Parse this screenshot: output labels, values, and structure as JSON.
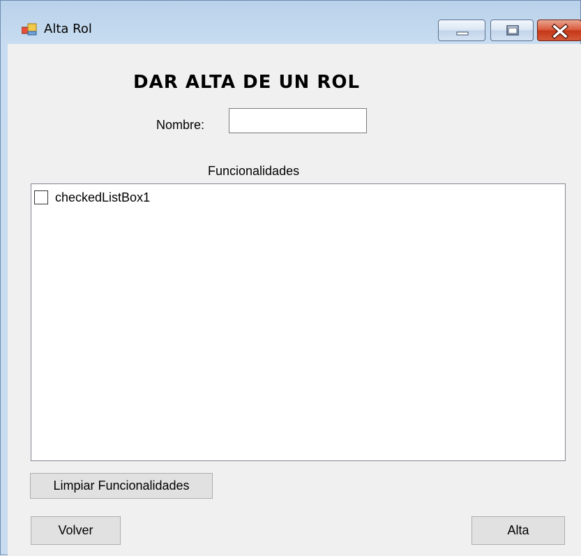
{
  "window": {
    "title": "Alta Rol",
    "icon": "winforms-app-icon",
    "controls": [
      "minimize-icon",
      "maximize-icon",
      "close-icon"
    ],
    "accent": "#c9dcef",
    "close_color": "#c43717"
  },
  "form": {
    "heading": "DAR ALTA DE UN ROL",
    "nombre_label": "Nombre:",
    "nombre_value": "",
    "funcionalidades_label": "Funcionalidades",
    "list_items": [
      {
        "label": "checkedListBox1",
        "checked": false
      }
    ],
    "limpiar_label": "Limpiar Funcionalidades",
    "volver_label": "Volver",
    "alta_label": "Alta"
  }
}
